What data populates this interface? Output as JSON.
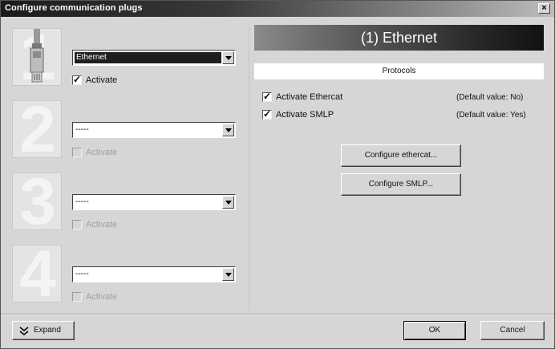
{
  "window": {
    "title": "Configure communication plugs",
    "close_label": "×"
  },
  "plugs": [
    {
      "number": "1",
      "combo_value": "Ethernet",
      "activate_label": "Activate",
      "checked": true,
      "enabled": true
    },
    {
      "number": "2",
      "combo_value": "-----",
      "activate_label": "Activate",
      "checked": false,
      "enabled": false
    },
    {
      "number": "3",
      "combo_value": "-----",
      "activate_label": "Activate",
      "checked": false,
      "enabled": false
    },
    {
      "number": "4",
      "combo_value": "-----",
      "activate_label": "Activate",
      "checked": false,
      "enabled": false
    }
  ],
  "right_panel": {
    "header": "(1) Ethernet",
    "protocols_label": "Protocols",
    "protocols": [
      {
        "label": "Activate Ethercat",
        "default_text": "(Default value: No)",
        "checked": true
      },
      {
        "label": "Activate SMLP",
        "default_text": "(Default value: Yes)",
        "checked": true
      }
    ],
    "configure_ethercat_label": "Configure ethercat...",
    "configure_smlp_label": "Configure SMLP..."
  },
  "footer": {
    "expand_label": "Expand",
    "ok_label": "OK",
    "cancel_label": "Cancel"
  },
  "colors": {
    "title_dark": "#1a1a1a",
    "face": "#d6d6d6",
    "header_dark": "#111111"
  }
}
